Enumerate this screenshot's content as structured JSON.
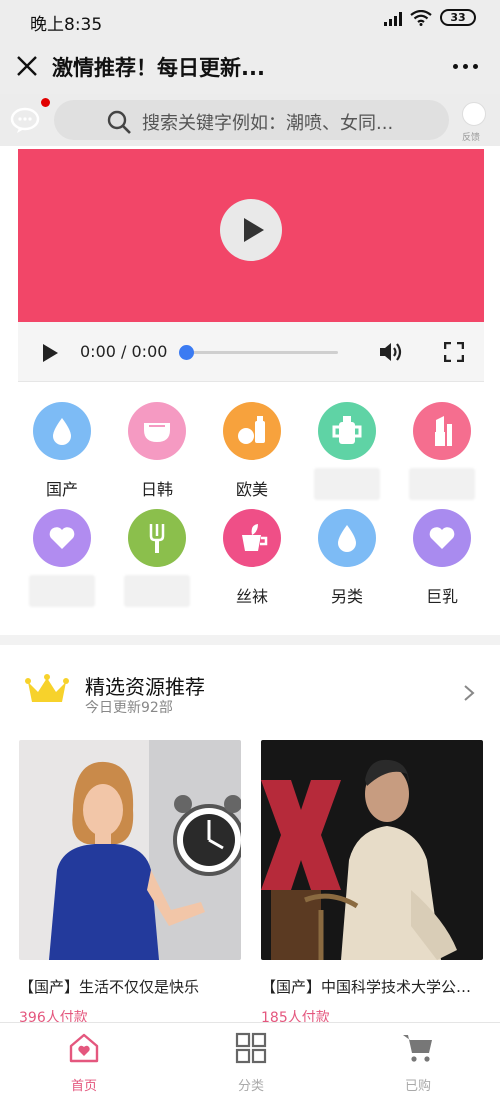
{
  "status_bar": {
    "time": "晚上8:35",
    "battery": "33"
  },
  "header": {
    "title": "激情推荐！每日更新..."
  },
  "search": {
    "placeholder": "搜索关键字例如：潮喷、女同...",
    "feedback_label": "反馈"
  },
  "video": {
    "time_display": "0:00 / 0:00",
    "progress": 0
  },
  "categories": [
    {
      "label": "国产",
      "color": "#7dbbf5",
      "icon": "water-drop-icon"
    },
    {
      "label": "日韩",
      "color": "#f59ac2",
      "icon": "diaper-icon"
    },
    {
      "label": "欧美",
      "color": "#f7a23d",
      "icon": "food-bottle-icon"
    },
    {
      "label": "",
      "color": "#5fd3a5",
      "icon": "sippy-cup-icon"
    },
    {
      "label": "",
      "color": "#f56e8f",
      "icon": "lipstick-icon"
    },
    {
      "label": "",
      "color": "#b18cf0",
      "icon": "heart-icon"
    },
    {
      "label": "",
      "color": "#8bbf4c",
      "icon": "fork-icon"
    },
    {
      "label": "丝袜",
      "color": "#ef4f87",
      "icon": "plant-pot-icon"
    },
    {
      "label": "另类",
      "color": "#7dbbf5",
      "icon": "water-drop-icon"
    },
    {
      "label": "巨乳",
      "color": "#a98bef",
      "icon": "heart-icon"
    }
  ],
  "recommend": {
    "title": "精选资源推荐",
    "subtitle": "今日更新92部"
  },
  "cards": [
    {
      "title": "【国产】生活不仅仅是快乐",
      "paid": "396人付款"
    },
    {
      "title": "【国产】中国科学技术大学公…",
      "paid": "185人付款"
    }
  ],
  "bottom_nav": [
    {
      "label": "首页",
      "icon": "home-icon",
      "active": true
    },
    {
      "label": "分类",
      "icon": "grid-icon",
      "active": false
    },
    {
      "label": "已购",
      "icon": "cart-icon",
      "active": false
    }
  ],
  "colors": {
    "accent": "#e4577e",
    "video_bg": "#f24668",
    "progress_thumb": "#3b7bf2"
  }
}
